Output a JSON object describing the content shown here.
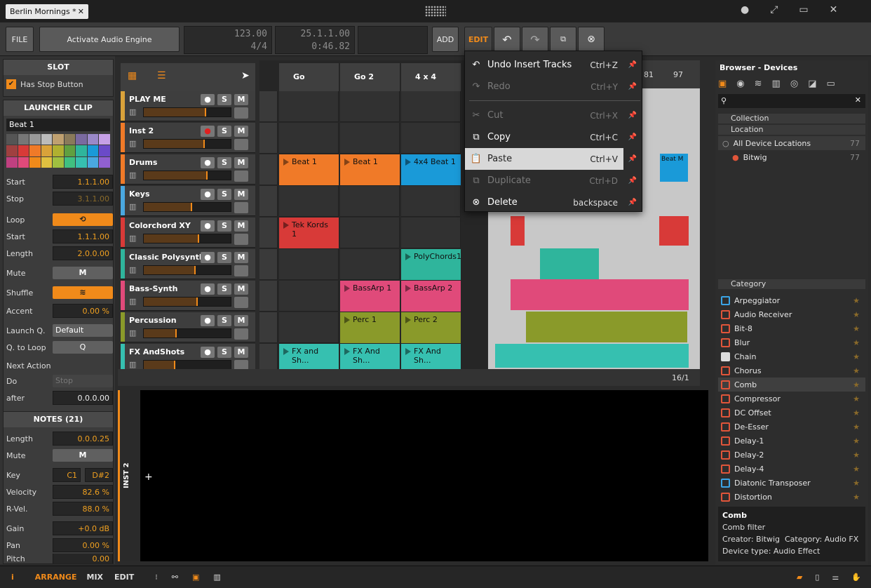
{
  "window": {
    "doc_tab": "Berlin Mornings *",
    "close_glyph": "✕",
    "controls": [
      "●",
      "⤢",
      "▭",
      "✕"
    ]
  },
  "toolbar": {
    "file": "FILE",
    "audio_engine": "Activate Audio Engine",
    "tempo": "123.00",
    "signature": "4/4",
    "position": "25.1.1.00",
    "time": "0:46.82",
    "add": "ADD",
    "edit": "EDIT"
  },
  "inspector": {
    "slot": {
      "title": "SLOT",
      "has_stop": "Has Stop Button"
    },
    "launcher": {
      "title": "LAUNCHER CLIP",
      "clip_name": "Beat 1",
      "start": "1.1.1.00",
      "stop": "3.1.1.00",
      "loop_start": "1.1.1.00",
      "length": "2.0.0.00",
      "mute": "M",
      "accent": "0.00 %",
      "launch_q": "Default",
      "q_to_loop": "Q",
      "next_action": "Next Action",
      "do": "Stop",
      "after": "0.0.0.00",
      "labels": {
        "start": "Start",
        "stop": "Stop",
        "loop": "Loop",
        "loop_start": "Start",
        "length": "Length",
        "mute": "Mute",
        "shuffle": "Shuffle",
        "accent": "Accent",
        "launch_q": "Launch Q.",
        "q_to_loop": "Q. to Loop",
        "do": "Do",
        "after": "after"
      }
    },
    "notes": {
      "title": "NOTES (21)",
      "length": "0.0.0.25",
      "mute": "M",
      "key_from": "C1",
      "key_to": "D#2",
      "velocity": "82.6 %",
      "r_vel": "88.0 %",
      "gain": "+0.0 dB",
      "pan": "0.00 %",
      "pitch": "0.00",
      "labels": {
        "length": "Length",
        "mute": "Mute",
        "key": "Key",
        "velocity": "Velocity",
        "r_vel": "R-Vel.",
        "gain": "Gain",
        "pan": "Pan",
        "pitch": "Pitch"
      }
    }
  },
  "tracks": [
    {
      "name": "PLAY ME",
      "color": "#d9a23a",
      "level": 0.72
    },
    {
      "name": "Inst 2",
      "color": "#f07a28",
      "level": 0.7
    },
    {
      "name": "Drums",
      "color": "#f07a28",
      "level": 0.73
    },
    {
      "name": "Keys",
      "color": "#4aa8e0",
      "level": 0.56
    },
    {
      "name": "Colorchord XY",
      "color": "#d83a38",
      "level": 0.64
    },
    {
      "name": "Classic Polysynth",
      "color": "#2fb59c",
      "level": 0.6
    },
    {
      "name": "Bass-Synth",
      "color": "#e04a7a",
      "level": 0.62
    },
    {
      "name": "Percussion",
      "color": "#8a9a2a",
      "level": 0.38
    },
    {
      "name": "FX AndShots",
      "color": "#36c0b0",
      "level": 0.36
    }
  ],
  "track_buttons": {
    "solo": "S",
    "mute": "M"
  },
  "scenes": [
    "Go",
    "Go 2",
    "4 x 4"
  ],
  "clips": [
    {
      "row": 2,
      "col": 0,
      "label": "Beat 1",
      "color": "#f07a28"
    },
    {
      "row": 2,
      "col": 1,
      "label": "Beat 1",
      "color": "#f07a28"
    },
    {
      "row": 2,
      "col": 2,
      "label": "4x4 Beat 1",
      "color": "#1a9ad8"
    },
    {
      "row": 4,
      "col": 0,
      "label": "Tek Kords 1",
      "color": "#d83a38"
    },
    {
      "row": 5,
      "col": 2,
      "label": "PolyChords1",
      "color": "#2fb59c"
    },
    {
      "row": 6,
      "col": 1,
      "label": "BassArp 1",
      "color": "#e04a7a"
    },
    {
      "row": 6,
      "col": 2,
      "label": "BassArp 2",
      "color": "#e04a7a"
    },
    {
      "row": 7,
      "col": 1,
      "label": "Perc 1",
      "color": "#8a9a2a"
    },
    {
      "row": 7,
      "col": 2,
      "label": "Perc 2",
      "color": "#8a9a2a"
    },
    {
      "row": 8,
      "col": 0,
      "label": "FX and Sh...",
      "color": "#36c0b0"
    },
    {
      "row": 8,
      "col": 1,
      "label": "FX And Sh...",
      "color": "#36c0b0"
    },
    {
      "row": 8,
      "col": 2,
      "label": "FX And Sh...",
      "color": "#36c0b0"
    }
  ],
  "arranger": {
    "ruler": [
      "81",
      "97"
    ],
    "zoom": "16/1"
  },
  "context_menu": {
    "items": [
      {
        "label": "Undo Insert Tracks",
        "shortcut": "Ctrl+Z",
        "icon": "↶",
        "disabled": false
      },
      {
        "label": "Redo",
        "shortcut": "Ctrl+Y",
        "icon": "↷",
        "disabled": true
      },
      {
        "label": "Cut",
        "shortcut": "Ctrl+X",
        "icon": "✂",
        "disabled": true
      },
      {
        "label": "Copy",
        "shortcut": "Ctrl+C",
        "icon": "⧉",
        "disabled": false
      },
      {
        "label": "Paste",
        "shortcut": "Ctrl+V",
        "icon": "📋",
        "disabled": false
      },
      {
        "label": "Duplicate",
        "shortcut": "Ctrl+D",
        "icon": "⧉",
        "disabled": true
      },
      {
        "label": "Delete",
        "shortcut": "backspace",
        "icon": "⊗",
        "disabled": false
      }
    ]
  },
  "browser": {
    "title": "Browser - Devices",
    "sections": {
      "collection": "Collection",
      "location": "Location",
      "category": "Category"
    },
    "locations": [
      {
        "label": "All Device Locations",
        "count": "77"
      },
      {
        "label": "Bitwig",
        "count": "77"
      }
    ],
    "categories": [
      {
        "label": "Arpeggiator",
        "kind": "note"
      },
      {
        "label": "Audio Receiver",
        "kind": "audio"
      },
      {
        "label": "Bit-8",
        "kind": "audio"
      },
      {
        "label": "Blur",
        "kind": "audio"
      },
      {
        "label": "Chain",
        "kind": "container"
      },
      {
        "label": "Chorus",
        "kind": "audio"
      },
      {
        "label": "Comb",
        "kind": "audio"
      },
      {
        "label": "Compressor",
        "kind": "audio"
      },
      {
        "label": "DC Offset",
        "kind": "audio"
      },
      {
        "label": "De-Esser",
        "kind": "audio"
      },
      {
        "label": "Delay-1",
        "kind": "audio"
      },
      {
        "label": "Delay-2",
        "kind": "audio"
      },
      {
        "label": "Delay-4",
        "kind": "audio"
      },
      {
        "label": "Diatonic Transposer",
        "kind": "note"
      },
      {
        "label": "Distortion",
        "kind": "audio"
      }
    ],
    "selected_index": 6,
    "info": {
      "name": "Comb",
      "desc": "Comb filter",
      "creator": "Creator: Bitwig",
      "category": "Category: Audio FX",
      "type": "Device type: Audio Effect"
    }
  },
  "editor": {
    "track_label": "INST 2",
    "plus": "+"
  },
  "statusbar": {
    "arrange": "ARRANGE",
    "mix": "MIX",
    "edit": "EDIT",
    "info": "i"
  },
  "colors": {
    "accent": "#f08a1a"
  }
}
